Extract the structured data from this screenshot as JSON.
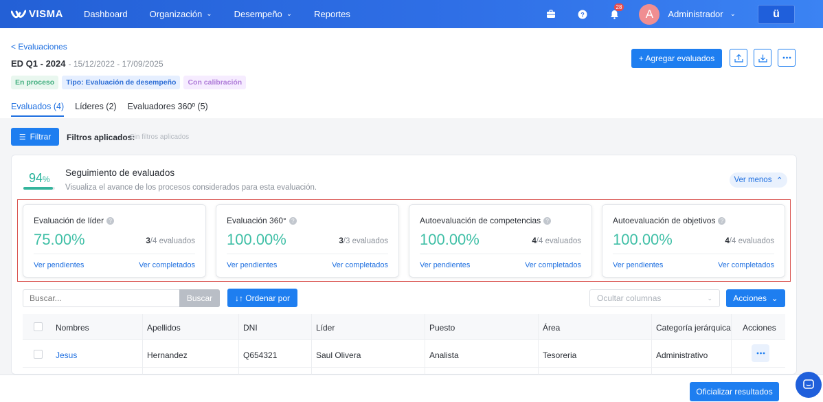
{
  "topbar": {
    "logo": "VISMA",
    "nav": [
      {
        "label": "Dashboard",
        "has_chevron": false
      },
      {
        "label": "Organización",
        "has_chevron": true
      },
      {
        "label": "Desempeño",
        "has_chevron": true
      },
      {
        "label": "Reportes",
        "has_chevron": false
      }
    ],
    "icons": [
      "briefcase-icon",
      "help-icon",
      "bell-icon"
    ],
    "notifications_count": "28",
    "avatar_initial": "A",
    "user_name": "Administrador",
    "app_button": "ü"
  },
  "header": {
    "back_link": "< Evaluaciones",
    "title": "ED Q1 - 2024",
    "dates": "- 15/12/2022 - 17/09/2025",
    "tags": [
      "En proceso",
      "Tipo: Evaluación de desempeño",
      "Con calibración"
    ],
    "tabs": [
      "Evaluados (4)",
      "Líderes (2)",
      "Evaluadores 360º (5)"
    ],
    "active_tab": 0,
    "add_button": "+ Agregar evaluados",
    "icon_buttons": [
      "upload-icon",
      "download-icon",
      "more-icon"
    ]
  },
  "filters": {
    "button": "Filtrar",
    "label": "Filtros aplicados:",
    "value": "Sin filtros aplicados"
  },
  "tracking": {
    "percent": "94",
    "percent_sign": "%",
    "progress": 0.94,
    "title": "Seguimiento de evaluados",
    "subtitle": "Visualiza el avance de los procesos considerados para esta evaluación.",
    "toggle": "Ver menos",
    "metrics": [
      {
        "title": "Evaluación de líder",
        "pct": "75.00%",
        "done": "3",
        "total": "/4 evaluados",
        "pending": "Ver pendientes",
        "completed": "Ver completados"
      },
      {
        "title": "Evaluación 360°",
        "pct": "100.00%",
        "done": "3",
        "total": "/3 evaluados",
        "pending": "Ver pendientes",
        "completed": "Ver completados"
      },
      {
        "title": "Autoevaluación de competencias",
        "pct": "100.00%",
        "done": "4",
        "total": "/4 evaluados",
        "pending": "Ver pendientes",
        "completed": "Ver completados"
      },
      {
        "title": "Autoevaluación de objetivos",
        "pct": "100.00%",
        "done": "4",
        "total": "/4 evaluados",
        "pending": "Ver pendientes",
        "completed": "Ver completados"
      }
    ]
  },
  "table_controls": {
    "search_placeholder": "Buscar...",
    "search_button": "Buscar",
    "order_button": "↓↑ Ordenar por",
    "hide_columns": "Ocultar columnas",
    "actions_button": "Acciones"
  },
  "table": {
    "headers": [
      "Nombres",
      "Apellidos",
      "DNI",
      "Líder",
      "Puesto",
      "Área",
      "Categoría jerárquica",
      "Acciones"
    ],
    "rows": [
      {
        "nombres": "Jesus",
        "apellidos": "Hernandez",
        "dni": "Q654321",
        "lider": "Saul Olivera",
        "puesto": "Analista",
        "area": "Tesoreria",
        "categoria": "Administrativo"
      }
    ]
  },
  "footer": {
    "button": "Oficializar resultados"
  },
  "colors": {
    "primary": "#1e7ef0",
    "teal": "#3fbfa6",
    "highlight_border": "#d9534f"
  }
}
